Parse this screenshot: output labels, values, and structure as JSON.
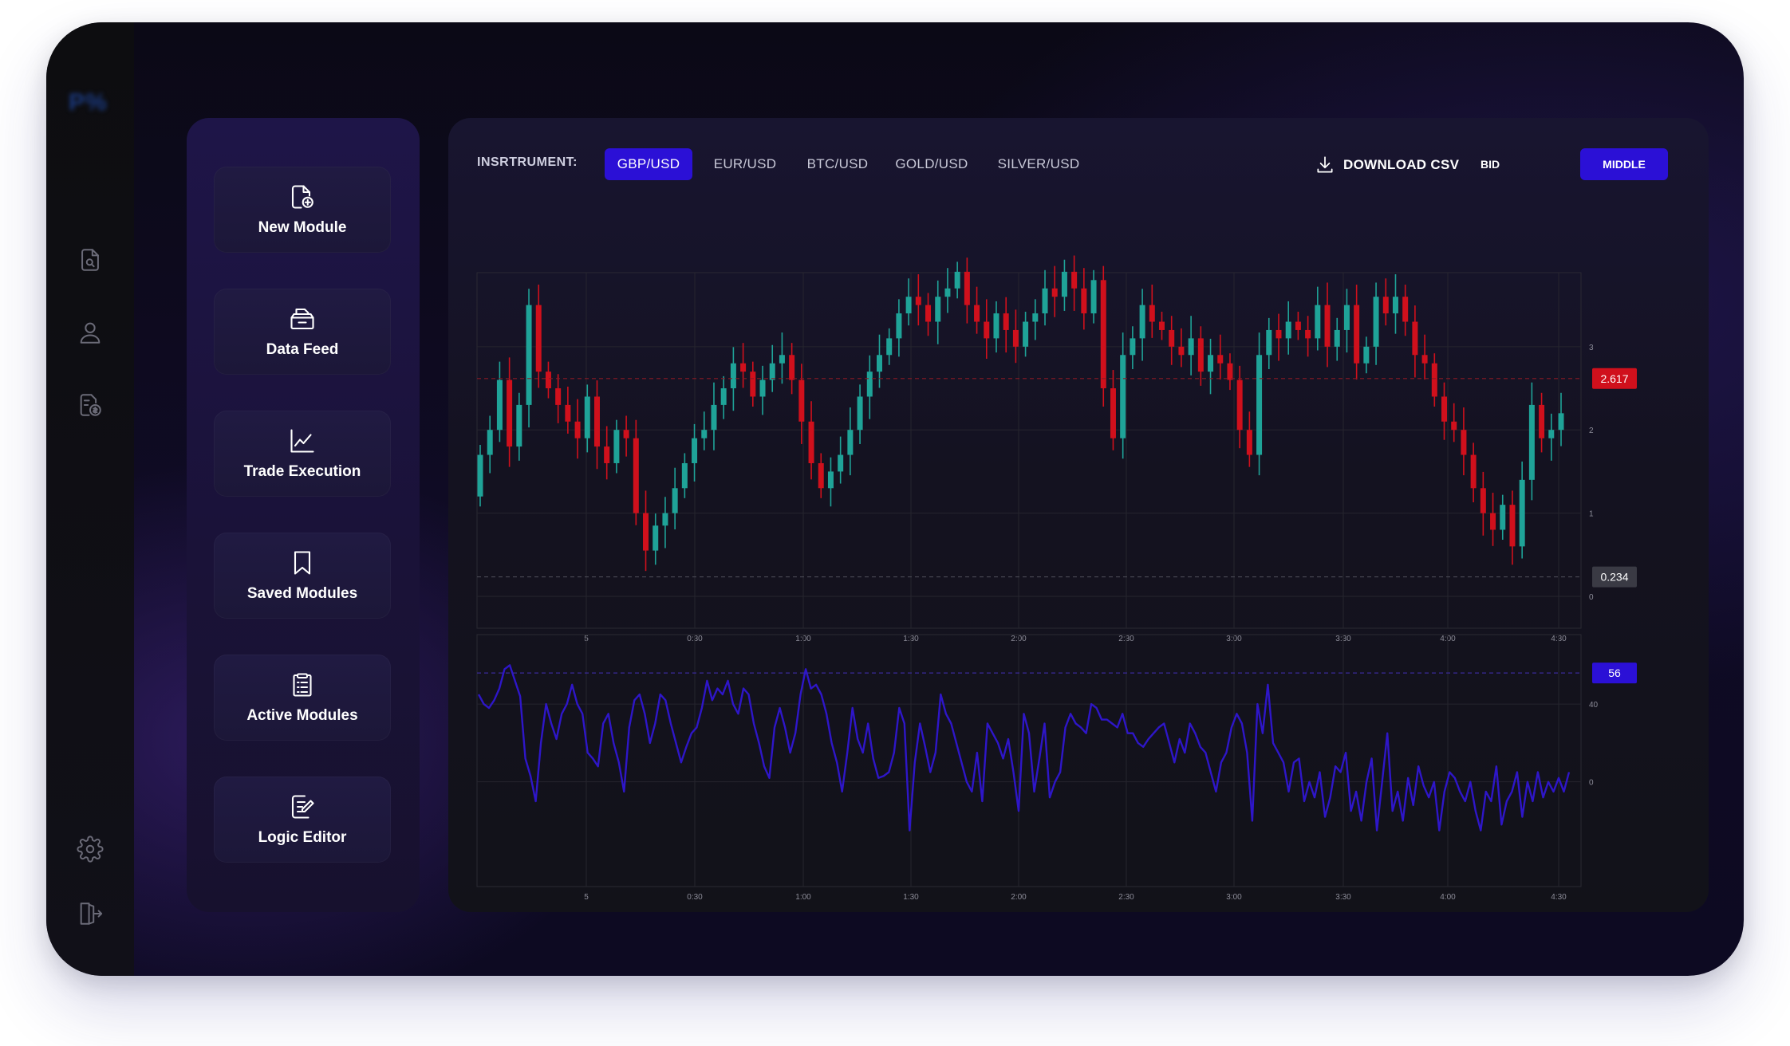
{
  "app": {
    "logo_text": "P%"
  },
  "rail": {
    "icons": [
      "document-search-icon",
      "user-icon",
      "invoice-icon",
      "gear-icon",
      "logout-icon"
    ]
  },
  "modules": [
    {
      "label": "New Module",
      "icon": "new-file-icon"
    },
    {
      "label": "Data Feed",
      "icon": "data-feed-icon"
    },
    {
      "label": "Trade Execution",
      "icon": "line-chart-icon"
    },
    {
      "label": "Saved Modules",
      "icon": "bookmark-icon"
    },
    {
      "label": "Active Modules",
      "icon": "clipboard-list-icon"
    },
    {
      "label": "Logic Editor",
      "icon": "edit-document-icon"
    }
  ],
  "toolbar": {
    "instrument_label": "INSRTRUMENT:",
    "instruments": [
      "GBP/USD",
      "EUR/USD",
      "BTC/USD",
      "GOLD/USD",
      "SILVER/USD"
    ],
    "active_instrument": "GBP/USD",
    "download_label": "DOWNLOAD CSV",
    "bid_label": "BID",
    "middle_label": "MIDDLE",
    "active_mode": "MIDDLE"
  },
  "colors": {
    "accent": "#2b10d6",
    "up": "#1fa398",
    "down": "#d0101c",
    "line": "#2e16c8"
  },
  "chart_data": [
    {
      "type": "candlestick",
      "x_ticks": [
        "5",
        "0:30",
        "1:00",
        "1:30",
        "2:00",
        "2:30",
        "3:00",
        "3:30",
        "4:00",
        "4:30"
      ],
      "y_ticks": [
        "0",
        "1",
        "2",
        "3"
      ],
      "ylim": [
        0,
        4.1
      ],
      "reference_lines": [
        {
          "value": 2.617,
          "label": "2.617",
          "color": "#d0101c"
        },
        {
          "value": 0.234,
          "label": "0.234",
          "color": "#3a3a44"
        }
      ],
      "closes": [
        1.7,
        2.0,
        2.6,
        1.8,
        2.3,
        3.5,
        2.7,
        2.5,
        2.3,
        2.1,
        1.9,
        2.4,
        1.8,
        1.6,
        2.0,
        1.9,
        1.0,
        0.55,
        0.85,
        1.0,
        1.3,
        1.6,
        1.9,
        2.0,
        2.3,
        2.5,
        2.8,
        2.7,
        2.4,
        2.6,
        2.8,
        2.9,
        2.6,
        2.1,
        1.6,
        1.3,
        1.5,
        1.7,
        2.0,
        2.4,
        2.7,
        2.9,
        3.1,
        3.4,
        3.6,
        3.5,
        3.3,
        3.6,
        3.7,
        3.9,
        3.5,
        3.3,
        3.1,
        3.4,
        3.2,
        3.0,
        3.3,
        3.4,
        3.7,
        3.6,
        3.9,
        3.7,
        3.4,
        3.8,
        2.5,
        1.9,
        2.9,
        3.1,
        3.5,
        3.3,
        3.2,
        3.0,
        2.9,
        3.1,
        2.7,
        2.9,
        2.8,
        2.6,
        2.0,
        1.7,
        2.9,
        3.2,
        3.1,
        3.3,
        3.2,
        3.1,
        3.5,
        3.0,
        3.2,
        3.5,
        2.8,
        3.0,
        3.6,
        3.4,
        3.6,
        3.3,
        2.9,
        2.8,
        2.4,
        2.1,
        2.0,
        1.7,
        1.3,
        1.0,
        0.8,
        1.1,
        0.6,
        1.4,
        2.3,
        1.9,
        2.0,
        2.2
      ]
    },
    {
      "type": "line",
      "x_ticks": [
        "5",
        "0:30",
        "1:00",
        "1:30",
        "2:00",
        "2:30",
        "3:00",
        "3:30",
        "4:00",
        "4:30"
      ],
      "y_ticks": [
        "0",
        "40"
      ],
      "ylim": [
        -35,
        70
      ],
      "reference_lines": [
        {
          "value": 56,
          "label": "56",
          "color": "#2b10d6"
        }
      ],
      "values": [
        45,
        40,
        38,
        42,
        48,
        58,
        60,
        52,
        44,
        12,
        3,
        -10,
        20,
        40,
        30,
        22,
        35,
        40,
        50,
        40,
        35,
        15,
        12,
        8,
        30,
        35,
        20,
        10,
        -5,
        28,
        42,
        45,
        35,
        20,
        30,
        45,
        42,
        30,
        20,
        10,
        18,
        25,
        28,
        38,
        52,
        42,
        48,
        45,
        52,
        40,
        35,
        48,
        45,
        30,
        20,
        8,
        2,
        28,
        38,
        28,
        15,
        25,
        45,
        58,
        48,
        50,
        45,
        35,
        20,
        10,
        -5,
        15,
        38,
        22,
        15,
        30,
        12,
        2,
        3,
        5,
        15,
        38,
        30,
        -25,
        10,
        30,
        18,
        5,
        15,
        45,
        35,
        30,
        20,
        10,
        0,
        -5,
        15,
        -10,
        30,
        25,
        20,
        12,
        22,
        5,
        -15,
        35,
        25,
        -5,
        12,
        30,
        -8,
        0,
        5,
        28,
        35,
        30,
        28,
        25,
        40,
        38,
        32,
        32,
        30,
        28,
        35,
        25,
        25,
        20,
        18,
        22,
        25,
        28,
        30,
        20,
        10,
        22,
        15,
        30,
        25,
        18,
        15,
        5,
        -5,
        10,
        15,
        28,
        35,
        30,
        15,
        -20,
        40,
        25,
        50,
        20,
        15,
        10,
        -5,
        10,
        12,
        -10,
        0,
        -8,
        5,
        -18,
        -8,
        8,
        5,
        15,
        -15,
        -5,
        -20,
        0,
        12,
        -25,
        0,
        25,
        -15,
        -5,
        -20,
        2,
        -12,
        8,
        -2,
        -8,
        0,
        -25,
        -5,
        5,
        2,
        -5,
        -10,
        0,
        -15,
        -25,
        -5,
        -10,
        8,
        -22,
        -10,
        -5,
        5,
        -18,
        0,
        -10,
        5,
        -8,
        0,
        -5,
        2,
        -5,
        5
      ]
    }
  ]
}
